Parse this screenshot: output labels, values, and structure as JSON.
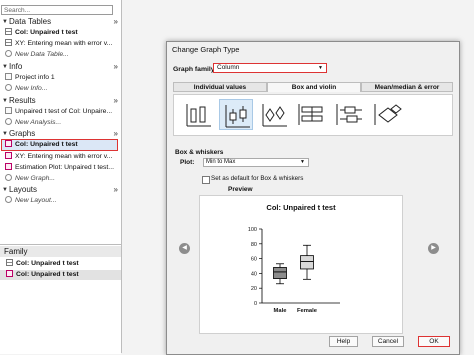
{
  "navigator": {
    "search_placeholder": "Search...",
    "sections": {
      "data_tables": "Data Tables",
      "info": "Info",
      "results": "Results",
      "graphs": "Graphs",
      "layouts": "Layouts"
    },
    "data_tables_items": [
      "Col: Unpaired t test",
      "XY: Entering mean with error v..."
    ],
    "new_data_table": "New Data Table...",
    "info_items": [
      "Project info 1"
    ],
    "new_info": "New Info...",
    "results_items": [
      "Unpaired t test of Col: Unpaire..."
    ],
    "new_analysis": "New Analysis...",
    "graphs_items": [
      "Col: Unpaired t test",
      "XY: Entering mean with error v...",
      "Estimation Plot: Unpaired t test..."
    ],
    "new_graph": "New Graph...",
    "new_layout": "New Layout...",
    "family": {
      "title": "Family",
      "items": [
        "Col: Unpaired t test",
        "Col: Unpaired t test"
      ]
    }
  },
  "dialog": {
    "title": "Change Graph Type",
    "graph_family_label": "Graph family:",
    "graph_family_value": "Column",
    "tabs": [
      "Individual values",
      "Box and violin",
      "Mean/median & error"
    ],
    "active_tab": 1,
    "thumbnail_icons": [
      "scatter-bars-icon",
      "box-whisker-icon",
      "violin-icon",
      "horizontal-box-icon",
      "horizontal-box-whisker-icon",
      "horizontal-violin-icon"
    ],
    "selected_thumbnail": 1,
    "box_whiskers_label": "Box & whiskers",
    "plot_label": "Plot:",
    "plot_value": "Min to Max",
    "default_checkbox_label": "Set as default for Box & whiskers",
    "preview_label": "Preview",
    "buttons": {
      "help": "Help",
      "cancel": "Cancel",
      "ok": "OK"
    }
  },
  "chart_data": {
    "type": "box",
    "title": "Col: Unpaired t test",
    "categories": [
      "Male",
      "Female"
    ],
    "y_ticks": [
      "0",
      "20",
      "40",
      "60",
      "80",
      "100"
    ],
    "ylim": [
      0,
      100
    ],
    "boxes": [
      {
        "name": "Male",
        "min": 26,
        "q1": 33,
        "median": 42,
        "q3": 48,
        "max": 53,
        "fill": "#8c8c8c"
      },
      {
        "name": "Female",
        "min": 32,
        "q1": 46,
        "median": 56,
        "q3": 64,
        "max": 78,
        "fill": "#d9d9d9"
      }
    ],
    "grid": false
  }
}
